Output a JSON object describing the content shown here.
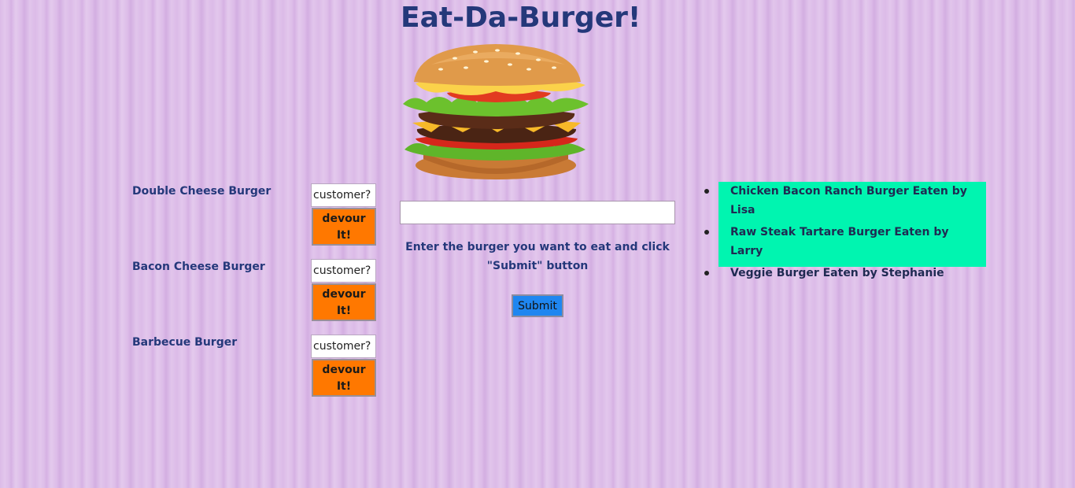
{
  "header": {
    "title": "Eat-Da-Burger!"
  },
  "burgers_to_eat": [
    {
      "name": "Double Cheese Burger",
      "customer_placeholder": "customer?",
      "devour_label": "devour It!"
    },
    {
      "name": "Bacon Cheese Burger",
      "customer_placeholder": "customer?",
      "devour_label": "devour It!"
    },
    {
      "name": "Barbecue Burger",
      "customer_placeholder": "customer?",
      "devour_label": "devour It!"
    }
  ],
  "new_burger": {
    "input_value": "",
    "instructions": "Enter the burger you want to eat and click \"Submit\" button",
    "submit_label": "Submit"
  },
  "eaten_burgers": [
    "Chicken Bacon Ranch Burger Eaten by Lisa",
    "Raw Steak Tartare Burger Eaten by Larry",
    "Veggie Burger Eaten by Stephanie"
  ],
  "colors": {
    "background": "#dcbbe8",
    "title": "#24387a",
    "devour_button": "#ff7800",
    "submit_button": "#1f86f0",
    "eaten_panel": "#00f5b0"
  },
  "icons": {
    "hero_image": "burger-image"
  }
}
